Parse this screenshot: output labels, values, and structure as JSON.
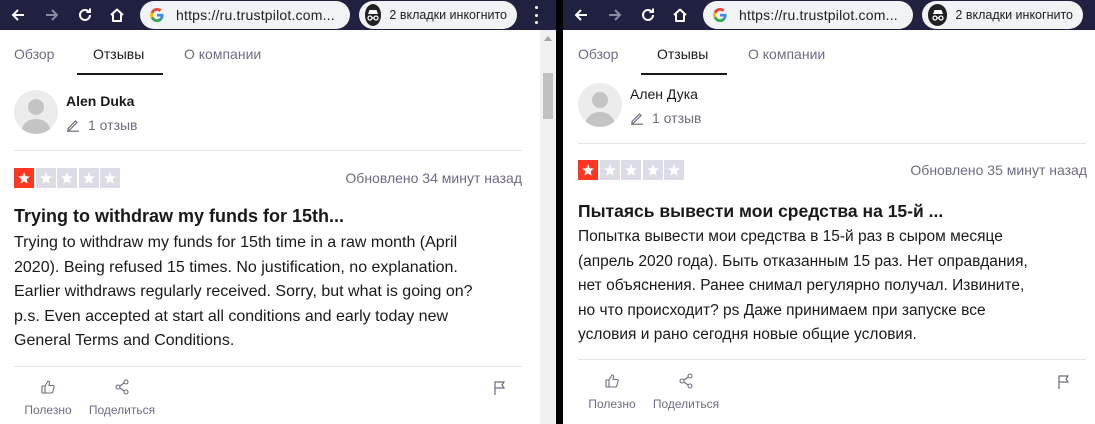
{
  "panes": [
    {
      "browser": {
        "url": "https://ru.trustpilot.com...",
        "incognito_label": "2 вкладки инкогнито"
      },
      "tabs": [
        {
          "label": "Обзор",
          "active": false
        },
        {
          "label": "Отзывы",
          "active": true
        },
        {
          "label": "О компании",
          "active": false
        }
      ],
      "review": {
        "author": "Alen Duka",
        "review_count": "1 отзыв",
        "stars": 1,
        "stars_max": 5,
        "updated": "Обновлено 34 минут назад",
        "title": "Trying to withdraw my funds for 15th...",
        "body_lines": [
          "Trying to withdraw my funds for 15th time in a raw month (April",
          "2020). Being refused 15 times. No justification, no explanation.",
          "Earlier withdraws regularly received. Sorry, but what is going on?",
          "p.s. Even accepted at start all conditions and early today new",
          "General Terms and Conditions."
        ],
        "useful_label": "Полезно",
        "share_label": "Поделиться"
      }
    },
    {
      "browser": {
        "url": "https://ru.trustpilot.com...",
        "incognito_label": "2 вкладки инкогнито"
      },
      "tabs": [
        {
          "label": "Обзор",
          "active": false
        },
        {
          "label": "Отзывы",
          "active": true
        },
        {
          "label": "О компании",
          "active": false
        }
      ],
      "review": {
        "author": "Ален Дука",
        "review_count": "1 отзыв",
        "stars": 1,
        "stars_max": 5,
        "updated": "Обновлено 35 минут назад",
        "title": "Пытаясь вывести мои средства на 15-й ...",
        "body_lines": [
          "Попытка вывести мои средства в 15-й раз в сыром месяце",
          "(апрель 2020 года). Быть отказанным 15 раз. Нет оправдания,",
          "нет объяснения. Ранее снимал регулярно получал. Извините,",
          "но что происходит? ps Даже принимаем при запуске все",
          "условия и рано сегодня новые общие условия."
        ],
        "useful_label": "Полезно",
        "share_label": "Поделиться"
      }
    }
  ],
  "colors": {
    "browser_bar": "#202040",
    "star_filled": "#ff3722",
    "star_empty": "#dcdce6",
    "text_primary": "#191919",
    "text_secondary": "#6c6c85"
  },
  "icons": [
    "back-arrow-icon",
    "forward-arrow-icon",
    "reload-icon",
    "home-icon",
    "google-g-icon",
    "incognito-icon",
    "menu-dots-icon",
    "pencil-icon",
    "star-icon",
    "thumbs-up-icon",
    "share-icon",
    "flag-icon"
  ]
}
